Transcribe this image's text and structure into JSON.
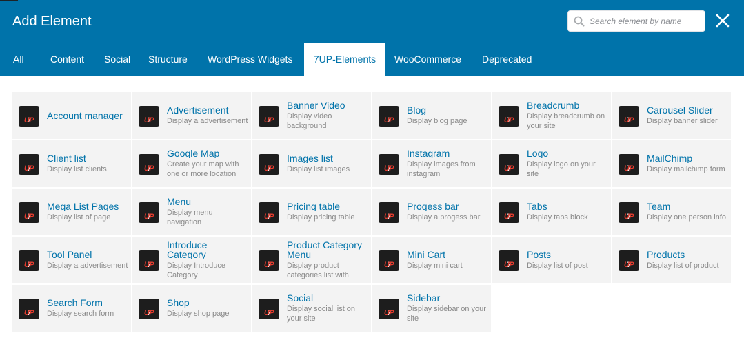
{
  "header": {
    "title": "Add Element",
    "search_placeholder": "Search element by name",
    "colors": {
      "bar": "#0073aa",
      "accent": "#0073aa",
      "text": "#ffffff"
    }
  },
  "tabs": [
    {
      "label": "All"
    },
    {
      "label": "Content"
    },
    {
      "label": "Social"
    },
    {
      "label": "Structure"
    },
    {
      "label": "WordPress Widgets"
    },
    {
      "label": "7UP-Elements",
      "active": true
    },
    {
      "label": "WooCommerce"
    },
    {
      "label": "Deprecated"
    }
  ],
  "logo": {
    "a": "7",
    "b": "UP",
    "color_a": "#ffffff",
    "color_b": "#e23b2e"
  },
  "elements": [
    {
      "name": "Account manager",
      "desc": ""
    },
    {
      "name": "Advertisement",
      "desc": "Display a advertisement"
    },
    {
      "name": "Banner Video",
      "desc": "Display video background"
    },
    {
      "name": "Blog",
      "desc": "Display blog page"
    },
    {
      "name": "Breadcrumb",
      "desc": "Display breadcrumb on your site"
    },
    {
      "name": "Carousel Slider",
      "desc": "Display banner slider"
    },
    {
      "name": "Client list",
      "desc": "Display list clients"
    },
    {
      "name": "Google Map",
      "desc": "Create your map with one or more location"
    },
    {
      "name": "Images list",
      "desc": "Display list images"
    },
    {
      "name": "Instagram",
      "desc": "Display images from instagram"
    },
    {
      "name": "Logo",
      "desc": "Display logo on your site"
    },
    {
      "name": "MailChimp",
      "desc": "Display mailchimp form"
    },
    {
      "name": "Mega List Pages",
      "desc": "Display list of page"
    },
    {
      "name": "Menu",
      "desc": "Display menu navigation"
    },
    {
      "name": "Pricing table",
      "desc": "Display pricing table"
    },
    {
      "name": "Progess bar",
      "desc": "Display a progess bar"
    },
    {
      "name": "Tabs",
      "desc": "Display tabs block"
    },
    {
      "name": "Team",
      "desc": "Display one person info"
    },
    {
      "name": "Tool Panel",
      "desc": "Display a advertisement"
    },
    {
      "name": "Introduce Category",
      "desc": "Display Introduce Category"
    },
    {
      "name": "Product Category Menu",
      "desc": "Display product categories list with icon/image"
    },
    {
      "name": "Mini Cart",
      "desc": "Display mini cart"
    },
    {
      "name": "Posts",
      "desc": "Display list of post"
    },
    {
      "name": "Products",
      "desc": "Display list of product"
    },
    {
      "name": "Search Form",
      "desc": "Display search form"
    },
    {
      "name": "Shop",
      "desc": "Display shop page"
    },
    {
      "name": "Social",
      "desc": "Display social list on your site"
    },
    {
      "name": "Sidebar",
      "desc": "Display sidebar on your site"
    }
  ]
}
